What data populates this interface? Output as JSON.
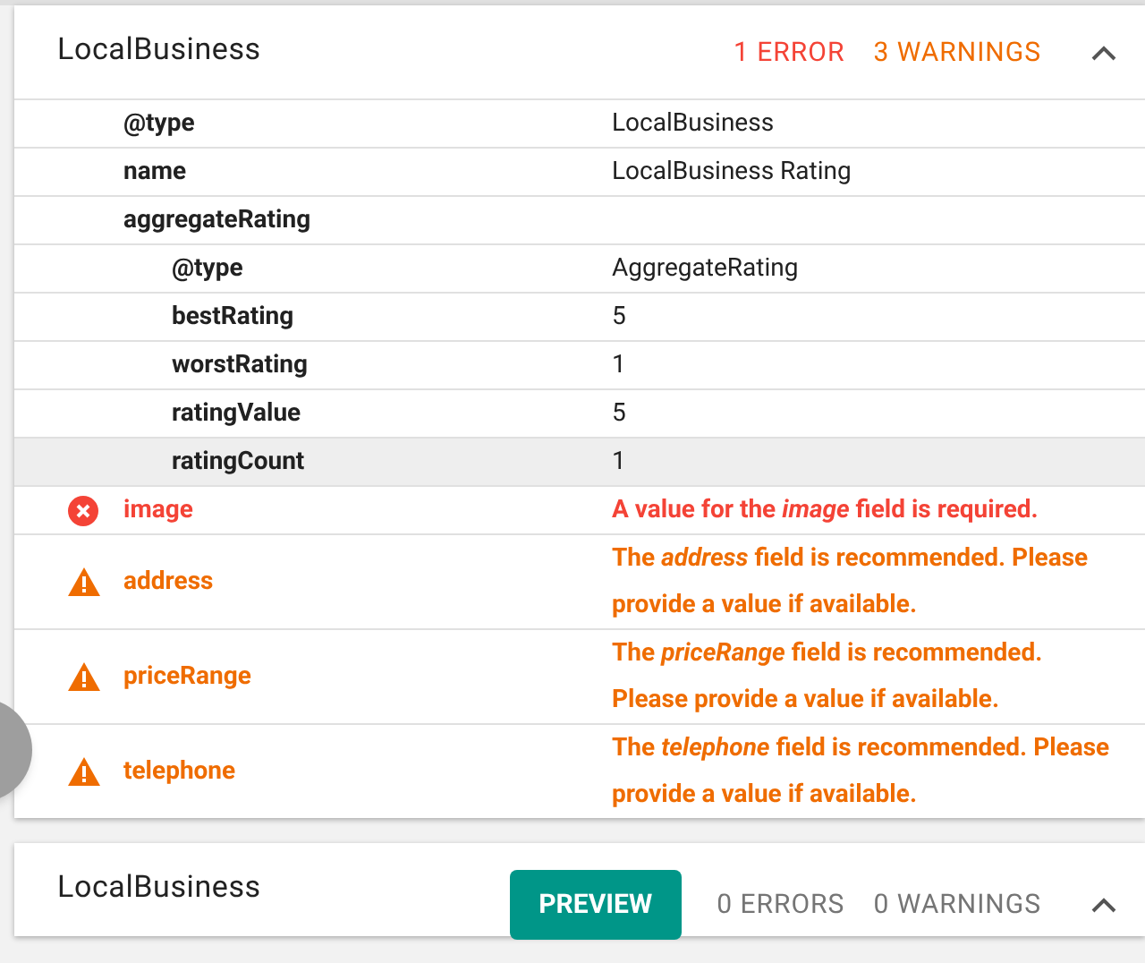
{
  "cards": [
    {
      "title": "LocalBusiness",
      "expanded": true,
      "errors": {
        "text": "1 ERROR",
        "flagged": true
      },
      "warnings": {
        "text": "3 WARNINGS",
        "flagged": true
      },
      "rows": [
        {
          "key": "@type",
          "value": "LocalBusiness",
          "highlighted": false
        },
        {
          "key": "name",
          "value": "LocalBusiness Rating",
          "highlighted": false
        },
        {
          "key": "aggregateRating",
          "highlighted": false,
          "children": [
            {
              "key": "@type",
              "value": "AggregateRating",
              "highlighted": false
            },
            {
              "key": "bestRating",
              "value": "5",
              "highlighted": false
            },
            {
              "key": "worstRating",
              "value": "1",
              "highlighted": false
            },
            {
              "key": "ratingValue",
              "value": "5",
              "highlighted": false
            },
            {
              "key": "ratingCount",
              "value": "1",
              "highlighted": true
            }
          ]
        }
      ],
      "issues": [
        {
          "kind": "error",
          "field": "image",
          "message": "A value for the *image* field is required."
        },
        {
          "kind": "warning",
          "field": "address",
          "message": "The *address* field is recommended. Please provide a value if available."
        },
        {
          "kind": "warning",
          "field": "priceRange",
          "message": "The *priceRange* field is recommended. Please provide a value if available."
        },
        {
          "kind": "warning",
          "field": "telephone",
          "message": "The *telephone* field is recommended. Please provide a value if available."
        }
      ]
    },
    {
      "title": "LocalBusiness",
      "expanded": true,
      "button": "PREVIEW",
      "errors": {
        "text": "0 ERRORS",
        "flagged": false
      },
      "warnings": {
        "text": "0 WARNINGS",
        "flagged": false
      }
    }
  ]
}
